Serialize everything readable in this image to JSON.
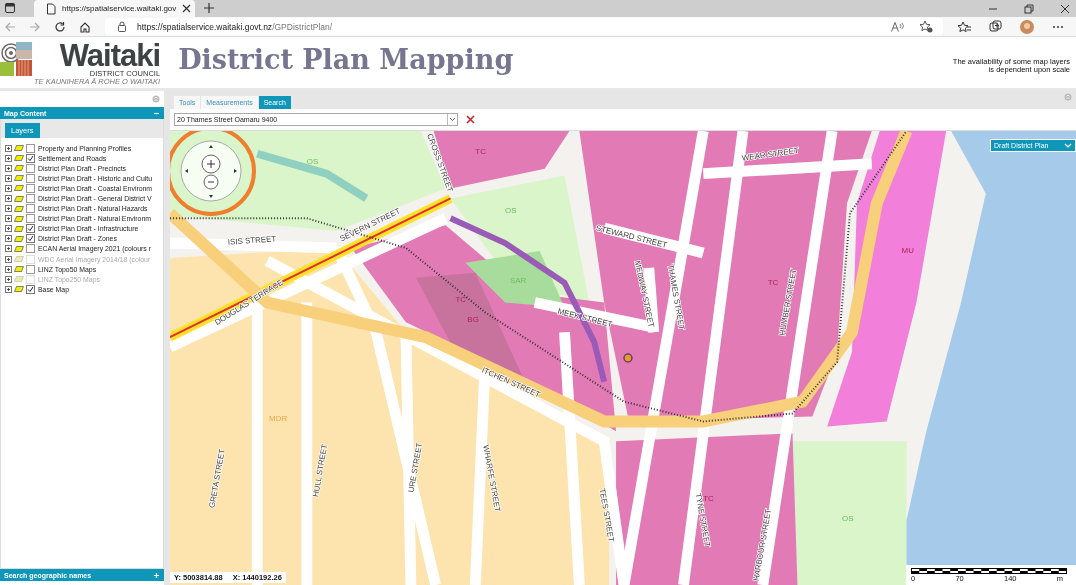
{
  "browser": {
    "tab_title": "https://spatialservice.waitaki.gov",
    "url_host": "https://spatialservice.waitaki.govt.nz",
    "url_path": "/GPDistrictPlan/"
  },
  "header": {
    "logo_name": "Waitaki",
    "logo_sub": "DISTRICT COUNCIL",
    "logo_motto": "TE KAUNIHERA Ā ROHE O WAITAKI",
    "title": "District Plan Mapping",
    "note": "The availability of some map layers is dependent upon scale"
  },
  "sidebar": {
    "title": "Map Content",
    "tabs": [
      {
        "label": "Layers",
        "selected": true
      }
    ],
    "layers": [
      {
        "label": "Property and Planning Profiles",
        "checked": false,
        "disabled": false
      },
      {
        "label": "Settlement and Roads",
        "checked": true,
        "disabled": false
      },
      {
        "label": "District Plan Draft - Precincts",
        "checked": false,
        "disabled": false
      },
      {
        "label": "District Plan Draft - Historic and Cultu",
        "checked": false,
        "disabled": false
      },
      {
        "label": "District Plan Draft - Coastal Environm",
        "checked": false,
        "disabled": false
      },
      {
        "label": "District Plan Draft - General District V",
        "checked": false,
        "disabled": false
      },
      {
        "label": "District Plan Draft - Natural Hazards",
        "checked": false,
        "disabled": false
      },
      {
        "label": "District Plan Draft - Natural Environm",
        "checked": false,
        "disabled": false
      },
      {
        "label": "District Plan Draft - Infrastructure",
        "checked": true,
        "disabled": false
      },
      {
        "label": "District Plan Draft - Zones",
        "checked": true,
        "disabled": false
      },
      {
        "label": "ECAN Aerial Imagery 2021 (colours r",
        "checked": false,
        "disabled": false
      },
      {
        "label": "WDC Aerial Imagery 2014/18 (colour",
        "checked": false,
        "disabled": true
      },
      {
        "label": "LINZ Topo50 Maps",
        "checked": false,
        "disabled": false
      },
      {
        "label": "LINZ Topo250 Maps",
        "checked": false,
        "disabled": true
      },
      {
        "label": "Base Map",
        "checked": true,
        "disabled": false
      }
    ],
    "footer": "Search geographic names"
  },
  "toolbar": {
    "tabs": [
      {
        "label": "Tools",
        "selected": false
      },
      {
        "label": "Measurements",
        "selected": false
      },
      {
        "label": "Search",
        "selected": true
      }
    ],
    "search_value": "20 Thames Street Oamaru 9400"
  },
  "map": {
    "layer_select": "Draft District Plan",
    "zones": [
      {
        "color": "#d9f5c9"
      },
      {
        "color": "#e27ab5"
      },
      {
        "color": "#fde3ad"
      },
      {
        "color": "#f27fd9"
      },
      {
        "color": "#a8dc9c"
      },
      {
        "color": "#c8739e"
      }
    ],
    "zone_labels": [
      "OS",
      "OS",
      "OS",
      "TC",
      "TC",
      "TC",
      "TC",
      "MDR",
      "MU",
      "SAR",
      "BG"
    ],
    "streets": [
      "CROSS STREET",
      "WEAR STREET",
      "ISIS STREET",
      "SEVERN STREET",
      "DOUGLAS TERRACE",
      "STEWARD STREET",
      "MEEK STREET",
      "ITCHEN STREET",
      "MEDWAY STREET",
      "THAMES STREET",
      "HUMBER STREET",
      "GRETA STREET",
      "HULL STREET",
      "URE STREET",
      "WHARFE STREET",
      "TEES STREET",
      "TYNE STREET",
      "HARBOUR STREET"
    ],
    "coordinates": {
      "y": "Y: 5003814.88",
      "x": "X: 1440192.26"
    },
    "scale": {
      "ticks": [
        "0",
        "70",
        "140"
      ],
      "unit": "m"
    }
  }
}
